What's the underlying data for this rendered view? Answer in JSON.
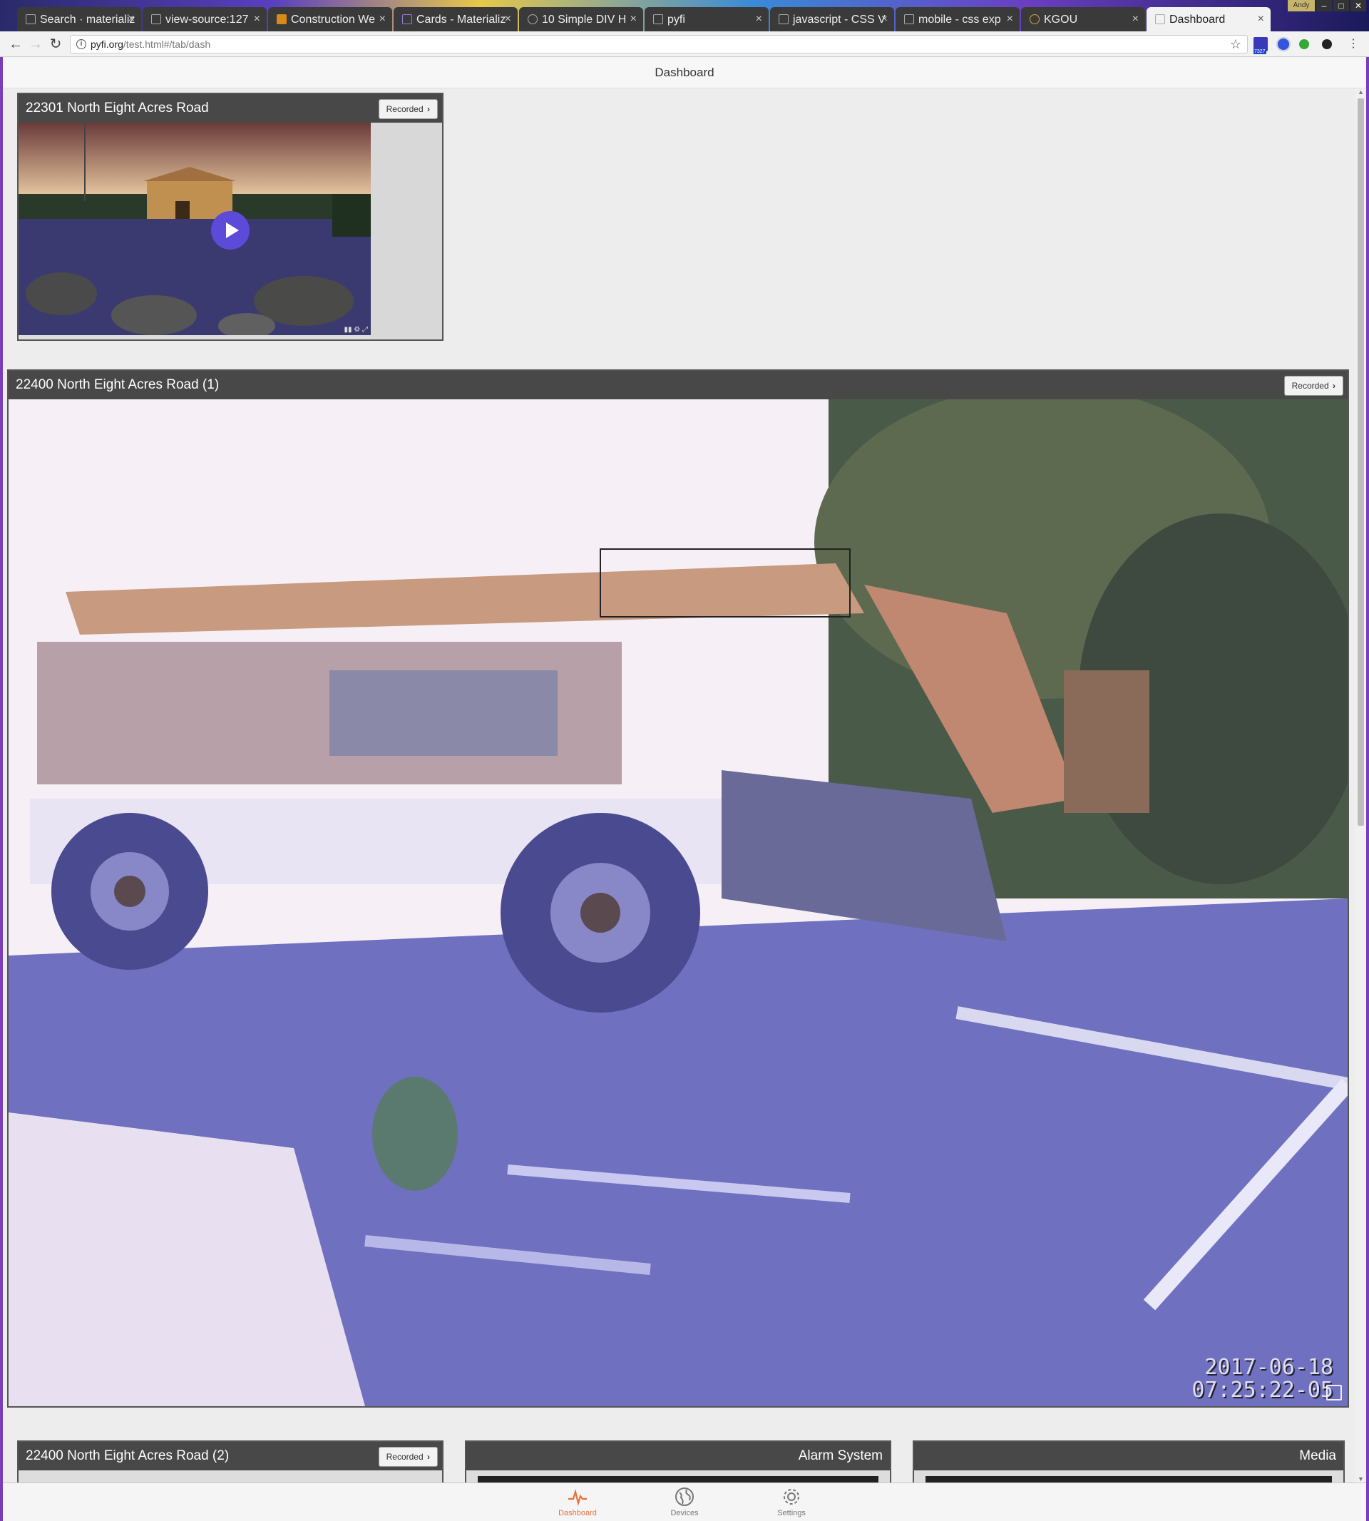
{
  "browser": {
    "tabs": [
      {
        "title": "Search · materializ",
        "active": false
      },
      {
        "title": "view-source:127",
        "active": false
      },
      {
        "title": "Construction We",
        "active": false
      },
      {
        "title": "Cards - Materializ",
        "active": false
      },
      {
        "title": "10 Simple DIV H",
        "active": false
      },
      {
        "title": "pyfi",
        "active": false
      },
      {
        "title": "javascript - CSS V",
        "active": false
      },
      {
        "title": "mobile - css exp",
        "active": false
      },
      {
        "title": "KGOU",
        "active": false
      },
      {
        "title": "Dashboard",
        "active": true
      }
    ],
    "user_label": "Andy",
    "url_host": "pyfi.org",
    "url_path": "/test.html#/tab/dash",
    "extension_badge": "7327"
  },
  "page": {
    "header_title": "Dashboard"
  },
  "cameras": [
    {
      "title": "22301 North Eight Acres Road",
      "recorded_label": "Recorded"
    },
    {
      "title": "22400 North Eight Acres Road (1)",
      "recorded_label": "Recorded",
      "timestamp_date": "2017-06-18",
      "timestamp_time": "07:25:22-05"
    },
    {
      "title": "22400 North Eight Acres Road (2)",
      "recorded_label": "Recorded"
    }
  ],
  "panels": {
    "alarm_title": "Alarm System",
    "media_title": "Media"
  },
  "bottom_nav": [
    {
      "label": "Dashboard",
      "icon": "pulse-icon",
      "active": true
    },
    {
      "label": "Devices",
      "icon": "globe-icon",
      "active": false
    },
    {
      "label": "Settings",
      "icon": "gear-icon",
      "active": false
    }
  ],
  "colors": {
    "accent": "#e8703a",
    "card_header": "#484848",
    "play_button": "#5b4bd8"
  }
}
